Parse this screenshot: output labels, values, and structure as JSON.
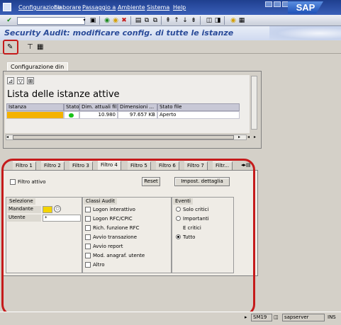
{
  "menubar": {
    "items": [
      "Configurazione",
      "Elaborare",
      "Passaggio a",
      "Ambiente",
      "Sistema",
      "Help"
    ],
    "logo": "SAP"
  },
  "toolbar": {
    "command_field_value": "",
    "icons": [
      "enter-icon",
      "save-icon",
      "back-icon",
      "exit-icon",
      "cancel-icon",
      "print-icon",
      "find-icon",
      "find-next-icon",
      "first-page-icon",
      "prev-page-icon",
      "next-page-icon",
      "last-page-icon",
      "new-session-icon",
      "shortcut-icon",
      "help-icon",
      "layout-icon"
    ]
  },
  "title": "Security Audit: modificare config. di tutte le istanze",
  "app_toolbar": {
    "icons": [
      "display-change-icon",
      "filter-icon",
      "details-icon"
    ]
  },
  "upper_tabs": [
    "Configurazione din"
  ],
  "instance_list": {
    "title": "Lista delle istanze attive",
    "columns": [
      "Istanza",
      "Stato",
      "Dim. attuali file",
      "Dimensioni ...",
      "Stato file"
    ],
    "rows": [
      {
        "instance": "",
        "status": "green",
        "current_size": "10.980",
        "size": "97.657 KB",
        "file_status": "Aperto"
      }
    ]
  },
  "filter_tabs": [
    "Filtro 1",
    "Filtro 2",
    "Filtro 3",
    "Filtro 4",
    "Filtro 5",
    "Filtro 6",
    "Filtro 7",
    "Filtr..."
  ],
  "active_filter_tab": "Filtro 4",
  "filter": {
    "active_label": "Filtro attivo",
    "active": false,
    "reset_label": "Reset",
    "detail_button": "Impost. dettaglia"
  },
  "selection": {
    "title": "Selezione",
    "client_label": "Mandante",
    "client_value": "",
    "user_label": "Utente",
    "user_value": "*"
  },
  "audit_classes": {
    "title": "Classi Audit",
    "items": [
      "Logon interattivo",
      "Logon RFC/CPIC",
      "Rich. funzione RFC",
      "Avvio transazione",
      "Avvio report",
      "Mod. anagraf. utente",
      "Altro"
    ]
  },
  "events": {
    "title": "Eventi",
    "options": [
      "Solo critici",
      "Importanti",
      "E critici",
      "Tutto"
    ],
    "selected": "Tutto"
  },
  "status_bar": {
    "transaction": "SM19",
    "server": "sapserver"
  },
  "colors": {
    "menubar": "#1f3f8f",
    "title_text": "#2a4b99",
    "highlight": "#c51b1b",
    "status_ok": "#19c219",
    "selected_cell": "#f4b200"
  }
}
